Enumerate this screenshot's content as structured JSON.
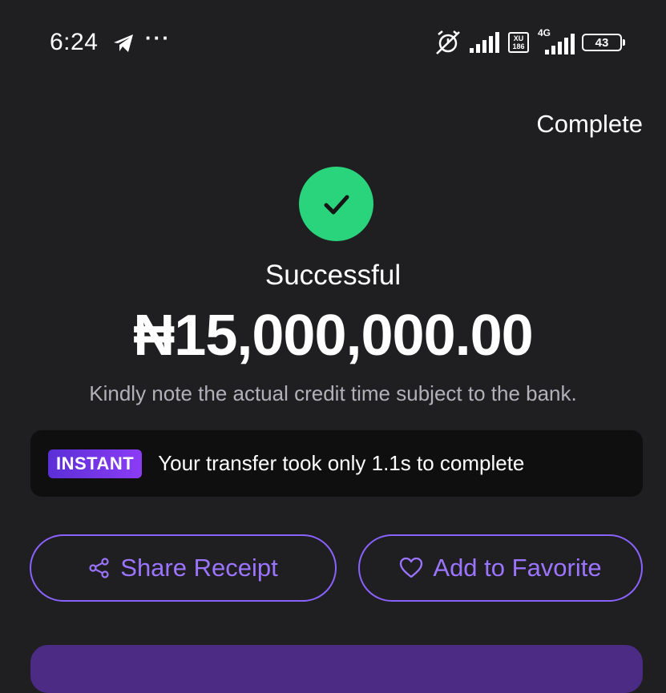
{
  "status_bar": {
    "time": "6:24",
    "icons": [
      "telegram-icon",
      "more-dots-icon",
      "alarm-off-icon",
      "signal-icon",
      "xu-network-icon",
      "4g-signal-icon",
      "battery-icon"
    ],
    "more": "···",
    "xu_label": "XU",
    "xu_sub": "186",
    "network_type": "4G",
    "battery_level": "43"
  },
  "header": {
    "complete_label": "Complete"
  },
  "result": {
    "status": "Successful",
    "amount": "₦15,000,000.00",
    "note": "Kindly note the actual credit time subject to the bank.",
    "success_color": "#2ad47d"
  },
  "instant": {
    "badge": "INSTANT",
    "message": "Your transfer took only 1.1s to complete"
  },
  "actions": {
    "share_label": "Share Receipt",
    "favorite_label": "Add to Favorite",
    "accent_color": "#8a62ff"
  }
}
